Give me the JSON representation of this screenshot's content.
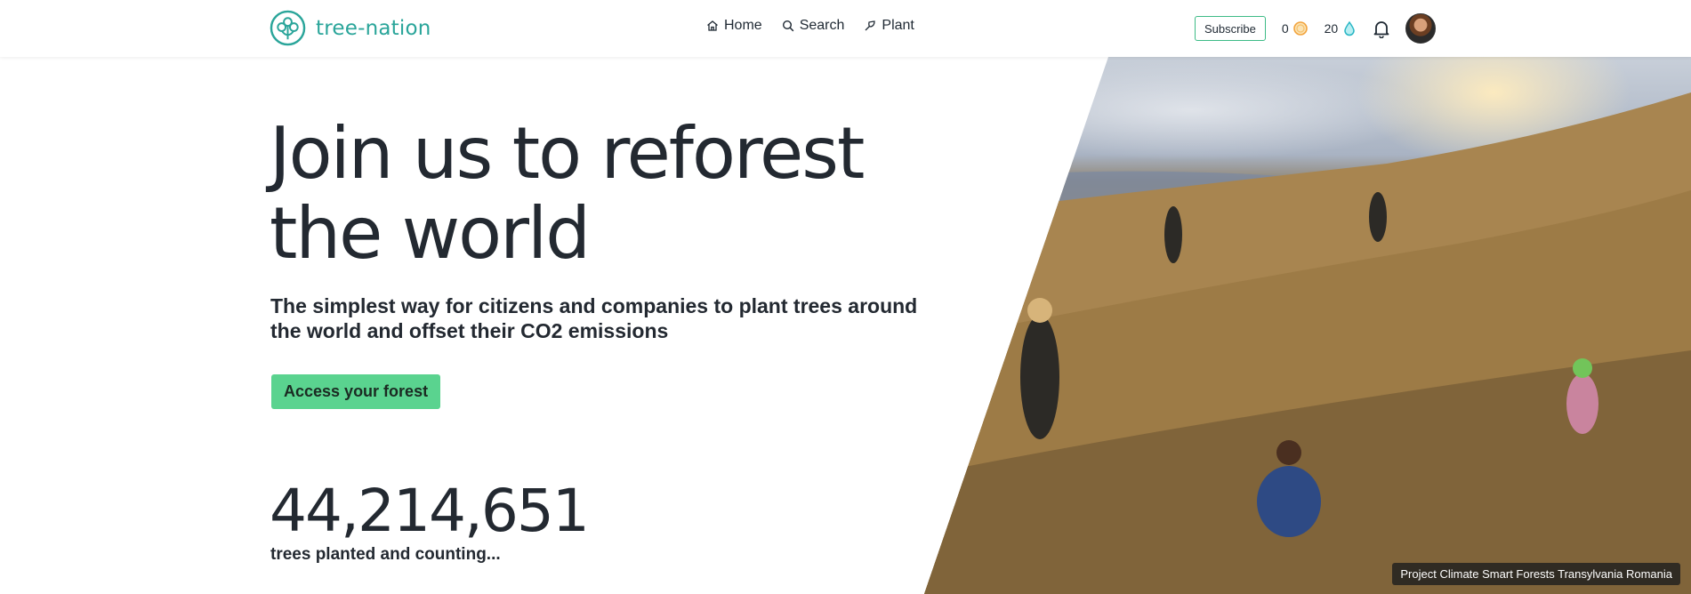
{
  "header": {
    "logo_text": "tree-nation",
    "nav": [
      {
        "label": "Home",
        "icon": "home-icon"
      },
      {
        "label": "Search",
        "icon": "search-icon"
      },
      {
        "label": "Plant",
        "icon": "plant-icon"
      }
    ],
    "subscribe_label": "Subscribe",
    "coins_count": "0",
    "drops_count": "20"
  },
  "hero": {
    "title": "Join us to reforest the world",
    "subtitle": "The simplest way for citizens and companies to plant trees around the world and offset their CO2 emissions",
    "cta_label": "Access your forest",
    "stat_number": "44,214,651",
    "stat_label": "trees planted and counting...",
    "photo_caption": "Project Climate Smart Forests Transylvania Romania"
  },
  "colors": {
    "brand": "#2aa59a",
    "cta": "#5ad38f",
    "subscribe_border": "#3dbb86",
    "text": "#232931"
  }
}
